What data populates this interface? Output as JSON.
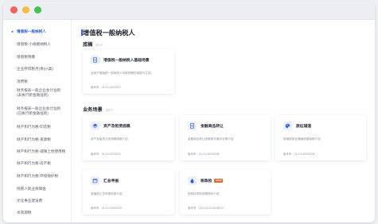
{
  "sidebar": {
    "items": [
      {
        "label": "增值税一般纳税人",
        "active": true
      },
      {
        "label": "增值税-小规模纳税人"
      },
      {
        "label": "增值税预缴"
      },
      {
        "label": "企业所得税月(季)(A类)"
      },
      {
        "label": "消费税"
      },
      {
        "label": "财务报表一般企业会计准则",
        "label2": "(未执行新金融准则)"
      },
      {
        "label": "财务报表一般企业会计准则",
        "label2": "(已执行新金融准则)"
      },
      {
        "label": "财产和行为税-印花税"
      },
      {
        "label": "财产和行为税-资源税"
      },
      {
        "label": "财产和行为税-城镇土地使用税"
      },
      {
        "label": "财产和行为税-房产税"
      },
      {
        "label": "财产和行为税-环境保护税"
      },
      {
        "label": "残疾人就业保障金"
      },
      {
        "label": "文化事业建设费"
      },
      {
        "label": "水资源税"
      }
    ]
  },
  "main": {
    "title": "增值税一般纳税人",
    "sections": [
      {
        "title": "底稿",
        "sub": "共1个"
      },
      {
        "title": "业务场景",
        "sub": "共5个"
      }
    ],
    "cards": [
      {
        "name": "增值税一般纳税人基础场景",
        "desc": "适用于增值税一般纳税人申报底稿的填报与生成。",
        "version": "版本号：V1.0.0.2023070",
        "icon": "document-icon"
      },
      {
        "name": "资产及租赁底稿",
        "desc": "资产及租赁业务底稿填报介绍",
        "version": "版本号：V1.0.0.2023070",
        "icon": "layers-icon"
      },
      {
        "name": "金融商品转让",
        "desc": "金融商品转让底稿填写操作说明介绍",
        "version": "版本号：V1.0.0.20230708",
        "icon": "receipt-icon"
      },
      {
        "name": "旅征辅道",
        "desc": "增值税旅征辅道底稿填报介绍",
        "version": "版本号：V1.0.0.20230704",
        "icon": "palette-icon"
      },
      {
        "name": "汇总申报",
        "desc": "增值税汇总申报填报介绍",
        "version": "版本号：V1.0.0.20033700",
        "icon": "calendar-icon"
      },
      {
        "name": "税政检",
        "badge": "NEW",
        "desc": "税政检风险底稿操作介绍",
        "version": "版本号：V0.0.01.02.20238717",
        "icon": "drop-icon"
      }
    ]
  },
  "colors": {
    "accent": "#2a5fd6",
    "badge": "#f0662a"
  }
}
